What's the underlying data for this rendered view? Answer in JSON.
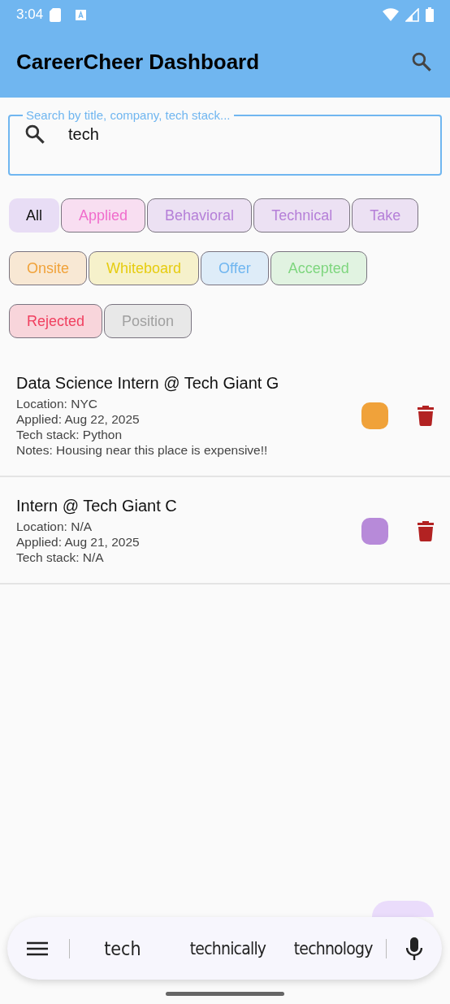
{
  "status_bar": {
    "time": "3:04"
  },
  "app_bar": {
    "title": "CareerCheer Dashboard"
  },
  "search": {
    "placeholder": "Search by title, company, tech stack...",
    "value": "tech"
  },
  "filters": [
    {
      "label": "All",
      "selected": true
    },
    {
      "label": "Applied",
      "selected": false,
      "color": "#f06ccc"
    },
    {
      "label": "Behavioral",
      "selected": false,
      "color": "#b57fd8"
    },
    {
      "label": "Technical",
      "selected": false,
      "color": "#b57fd8"
    },
    {
      "label": "Take",
      "selected": false,
      "color": "#b57fd8"
    },
    {
      "label": "Onsite",
      "selected": false,
      "color": "#f0a23a"
    },
    {
      "label": "Whiteboard",
      "selected": false,
      "color": "#e6cc10"
    },
    {
      "label": "Offer",
      "selected": false,
      "color": "#70b6f0"
    },
    {
      "label": "Accepted",
      "selected": false,
      "color": "#7ed67e"
    },
    {
      "label": "Rejected",
      "selected": false,
      "color": "#f04060"
    },
    {
      "label": "Position",
      "selected": false,
      "color": "#a0a0a0"
    }
  ],
  "jobs": [
    {
      "title": "Data Science Intern @ Tech Giant G",
      "lines": [
        "Location: NYC",
        "Applied: Aug 22, 2025",
        "Tech stack: Python",
        "Notes: Housing near this place is expensive!!"
      ],
      "color": "#f0a23a"
    },
    {
      "title": "Intern @ Tech Giant C",
      "lines": [
        "Location: N/A",
        "Applied: Aug 21, 2025",
        "Tech stack: N/A"
      ],
      "color": "#b78ad9"
    }
  ],
  "keyboard_suggestions": [
    "tech",
    "technically",
    "technology"
  ]
}
